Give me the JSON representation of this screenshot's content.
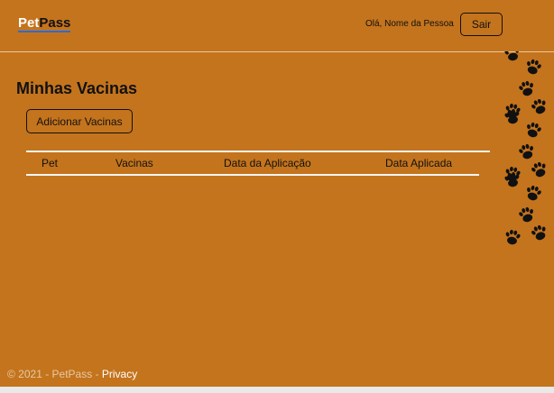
{
  "navbar": {
    "brand_part1": "Pet",
    "brand_part2": "Pass",
    "greeting": "Olá, Nome da Pessoa",
    "logout_label": "Sair"
  },
  "main": {
    "title": "Minhas Vacinas",
    "add_button_label": "Adicionar Vacinas",
    "table": {
      "headers": [
        "Pet",
        "Vacinas",
        "Data da Aplicação",
        "Data Aplicada"
      ],
      "rows": []
    }
  },
  "footer": {
    "copyright": "© 2021 - PetPass - ",
    "privacy_link": "Privacy"
  },
  "decor": {
    "icon": "paw-print-icon",
    "count": 15
  },
  "colors": {
    "background": "#c4741d",
    "brand_accent": "#ffffff",
    "footer_text": "#e6c9a3"
  }
}
